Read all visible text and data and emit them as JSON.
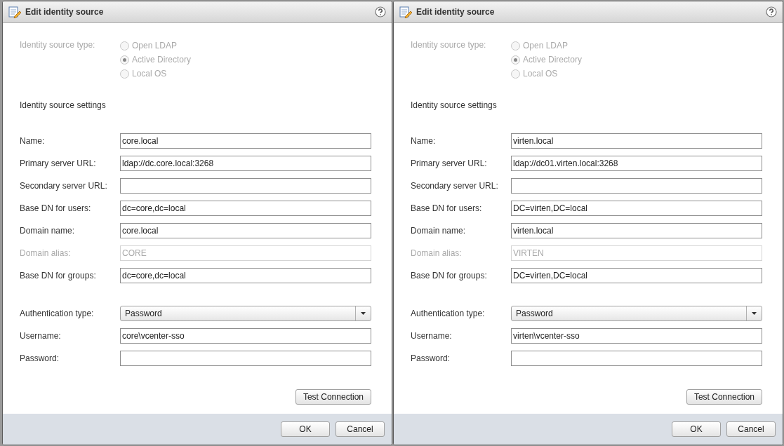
{
  "dialogs": [
    {
      "title": "Edit identity source",
      "source_type": {
        "label": "Identity source type:",
        "disabled": true,
        "options": [
          {
            "label": "Open LDAP",
            "selected": false
          },
          {
            "label": "Active Directory",
            "selected": true
          },
          {
            "label": "Local OS",
            "selected": false
          }
        ]
      },
      "section_title": "Identity source settings",
      "fields": [
        {
          "kind": "text",
          "label": "Name:",
          "value": "core.local",
          "disabled": false
        },
        {
          "kind": "text",
          "label": "Primary server URL:",
          "value": "ldap://dc.core.local:3268",
          "disabled": false
        },
        {
          "kind": "text",
          "label": "Secondary server URL:",
          "disabled": false
        },
        {
          "kind": "text",
          "label": "Base DN for users:",
          "value": "dc=core,dc=local",
          "disabled": false
        },
        {
          "kind": "text",
          "label": "Domain name:",
          "value": "core.local",
          "disabled": false
        },
        {
          "kind": "text",
          "label": "Domain alias:",
          "value": "CORE",
          "disabled": true
        },
        {
          "kind": "text",
          "label": "Base DN for groups:",
          "value": "dc=core,dc=local",
          "disabled": false
        }
      ],
      "auth_fields": [
        {
          "kind": "select",
          "label": "Authentication type:",
          "value": "Password",
          "disabled": false
        },
        {
          "kind": "text",
          "label": "Username:",
          "value": "core\\vcenter-sso",
          "disabled": false
        },
        {
          "kind": "text",
          "label": "Password:",
          "disabled": false
        }
      ],
      "test_button": "Test Connection",
      "buttons": [
        "OK",
        "Cancel"
      ]
    },
    {
      "title": "Edit identity source",
      "source_type": {
        "label": "Identity source type:",
        "disabled": true,
        "options": [
          {
            "label": "Open LDAP",
            "selected": false
          },
          {
            "label": "Active Directory",
            "selected": true
          },
          {
            "label": "Local OS",
            "selected": false
          }
        ]
      },
      "section_title": "Identity source settings",
      "fields": [
        {
          "kind": "text",
          "label": "Name:",
          "value": "virten.local",
          "disabled": false
        },
        {
          "kind": "text",
          "label": "Primary server URL:",
          "value": "ldap://dc01.virten.local:3268",
          "disabled": false
        },
        {
          "kind": "text",
          "label": "Secondary server URL:",
          "disabled": false
        },
        {
          "kind": "text",
          "label": "Base DN for users:",
          "value": "DC=virten,DC=local",
          "disabled": false
        },
        {
          "kind": "text",
          "label": "Domain name:",
          "value": "virten.local",
          "disabled": false
        },
        {
          "kind": "text",
          "label": "Domain alias:",
          "value": "VIRTEN",
          "disabled": true
        },
        {
          "kind": "text",
          "label": "Base DN for groups:",
          "value": "DC=virten,DC=local",
          "disabled": false
        }
      ],
      "auth_fields": [
        {
          "kind": "select",
          "label": "Authentication type:",
          "value": "Password",
          "disabled": false
        },
        {
          "kind": "text",
          "label": "Username:",
          "value": "virten\\vcenter-sso",
          "disabled": false
        },
        {
          "kind": "text",
          "label": "Password:",
          "disabled": false
        }
      ],
      "test_button": "Test Connection",
      "buttons": [
        "OK",
        "Cancel"
      ]
    }
  ]
}
